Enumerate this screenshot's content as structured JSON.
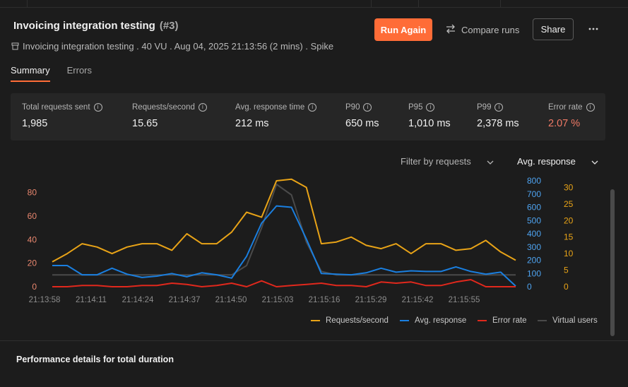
{
  "header": {
    "title": "Invoicing integration testing",
    "run_number": "(#3)",
    "subtitle": "Invoicing integration testing . 40 VU . Aug 04, 2025 21:13:56 (2 mins) . Spike",
    "run_again": "Run Again",
    "compare_runs": "Compare runs",
    "share": "Share",
    "more": "•••"
  },
  "tabs": [
    {
      "label": "Summary",
      "active": true
    },
    {
      "label": "Errors",
      "active": false
    }
  ],
  "stats": [
    {
      "label": "Total requests sent",
      "value": "1,985"
    },
    {
      "label": "Requests/second",
      "value": "15.65"
    },
    {
      "label": "Avg. response time",
      "value": "212 ms"
    },
    {
      "label": "P90",
      "value": "650 ms"
    },
    {
      "label": "P95",
      "value": "1,010 ms"
    },
    {
      "label": "P99",
      "value": "2,378 ms"
    },
    {
      "label": "Error rate",
      "value": "2.07 %"
    }
  ],
  "filters": {
    "requests": "Filter by requests",
    "metric": "Avg. response"
  },
  "colors": {
    "accent": "#ff6c37",
    "requests": "#e8a317",
    "avg_response": "#1a7fe0",
    "error_rate": "#e0281c",
    "virtual_users": "#4a4a4a"
  },
  "chart_data": {
    "type": "line",
    "x": [
      "21:13:58",
      "21:14:11",
      "21:14:24",
      "21:14:37",
      "21:14:50",
      "21:15:03",
      "21:15:16",
      "21:15:29",
      "21:15:42",
      "21:15:55"
    ],
    "axes": {
      "left": {
        "ticks": [
          "0",
          "20",
          "40",
          "60",
          "80"
        ],
        "range": [
          0,
          90
        ]
      },
      "right_response": {
        "ticks": [
          "0",
          "100",
          "200",
          "300",
          "400",
          "500",
          "600",
          "700",
          "800"
        ],
        "range": [
          0,
          800
        ]
      },
      "right_requests": {
        "ticks": [
          "0",
          "5",
          "10",
          "15",
          "20",
          "25",
          "30"
        ],
        "range": [
          0,
          32
        ]
      }
    },
    "grid": false,
    "legend_position": "bottom-right",
    "series": [
      {
        "name": "Requests/second",
        "axis": "right_requests",
        "values": [
          7.5,
          10,
          13,
          12,
          10,
          12,
          13,
          13,
          11,
          16,
          13,
          13,
          16.5,
          22.5,
          21,
          32,
          32.5,
          30,
          13,
          13.5,
          15,
          12.5,
          11.5,
          13,
          10,
          13,
          13,
          11,
          11.5,
          14,
          10.5,
          8
        ]
      },
      {
        "name": "Avg. response",
        "axis": "right_response",
        "values": [
          160,
          160,
          90,
          90,
          140,
          95,
          70,
          80,
          100,
          75,
          105,
          90,
          65,
          230,
          480,
          610,
          600,
          360,
          100,
          95,
          90,
          105,
          140,
          110,
          120,
          115,
          115,
          150,
          115,
          95,
          110,
          5
        ]
      },
      {
        "name": "Error rate",
        "axis": "left",
        "values": [
          0,
          0,
          1,
          1,
          0,
          0,
          1,
          1,
          3,
          2,
          0,
          1,
          3,
          0,
          5,
          0,
          1,
          2,
          3,
          1,
          1,
          0,
          4,
          3,
          4,
          1,
          1,
          4,
          6,
          0,
          0,
          0
        ]
      },
      {
        "name": "Virtual users",
        "axis": "left",
        "values": [
          10,
          10,
          10,
          10,
          10,
          10,
          10,
          10,
          10,
          10,
          10,
          10,
          10,
          18,
          50,
          87,
          78,
          38,
          13,
          10,
          10,
          10,
          10,
          10,
          10,
          10,
          10,
          10,
          10,
          10,
          10,
          10
        ]
      }
    ]
  },
  "section_title": "Performance details for total duration"
}
